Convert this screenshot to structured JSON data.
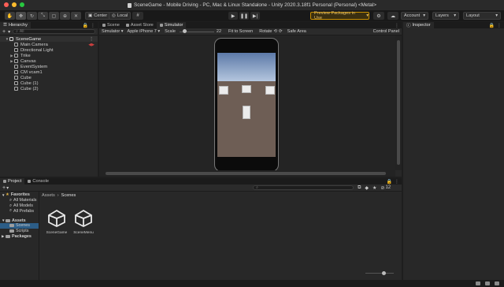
{
  "window": {
    "title": "SceneGame - Mobile Driving - PC, Mac & Linux Standalone - Unity 2020.3.18f1 Personal (Personal) <Metal>",
    "traffic_colors": [
      "#ff5f57",
      "#febc2e",
      "#28c840"
    ]
  },
  "toolbar": {
    "pivot_label": "Center",
    "space_label": "Local",
    "preview_label": "Preview Packages in Use",
    "account_label": "Account",
    "layers_label": "Layers",
    "layout_label": "Layout"
  },
  "hierarchy": {
    "tab_label": "Hierarchy",
    "search_placeholder": "All",
    "items": [
      {
        "label": "SceneGame",
        "depth": 0
      },
      {
        "label": "Main Camera",
        "depth": 1
      },
      {
        "label": "Directional Light",
        "depth": 1
      },
      {
        "label": "Trike",
        "depth": 1
      },
      {
        "label": "Canvas",
        "depth": 1
      },
      {
        "label": "EventSystem",
        "depth": 1
      },
      {
        "label": "CM vcam1",
        "depth": 1
      },
      {
        "label": "Cube",
        "depth": 1
      },
      {
        "label": "Cube (1)",
        "depth": 1
      },
      {
        "label": "Cube (2)",
        "depth": 1
      }
    ]
  },
  "center": {
    "tabs": [
      "Scene",
      "Asset Store",
      "Simulator"
    ],
    "active_tab": "Simulator",
    "sim_toolbar": {
      "mode": "Simulator",
      "device": "Apple iPhone 7",
      "scale_label": "Scale",
      "scale_value": "22",
      "fit_label": "Fit to Screen",
      "rotate_label": "Rotate",
      "safe_area_label": "Safe Area",
      "control_panel_label": "Control Panel"
    }
  },
  "inspector": {
    "tab_label": "Inspector"
  },
  "project": {
    "tabs": [
      "Project",
      "Console"
    ],
    "hidden_count": "12",
    "tree": [
      {
        "label": "Favorites",
        "kind": "star",
        "depth": 0
      },
      {
        "label": "All Materials",
        "kind": "search",
        "depth": 1
      },
      {
        "label": "All Models",
        "kind": "search",
        "depth": 1
      },
      {
        "label": "All Prefabs",
        "kind": "search",
        "depth": 1
      },
      {
        "label": "Assets",
        "kind": "folder",
        "depth": 0
      },
      {
        "label": "Scenes",
        "kind": "folder",
        "depth": 1,
        "selected": true
      },
      {
        "label": "Scripts",
        "kind": "folder",
        "depth": 1
      },
      {
        "label": "Packages",
        "kind": "folder",
        "depth": 0
      }
    ],
    "breadcrumb": [
      "Assets",
      "Scenes"
    ],
    "assets": [
      "SceneGame",
      "SceneMenu"
    ]
  }
}
